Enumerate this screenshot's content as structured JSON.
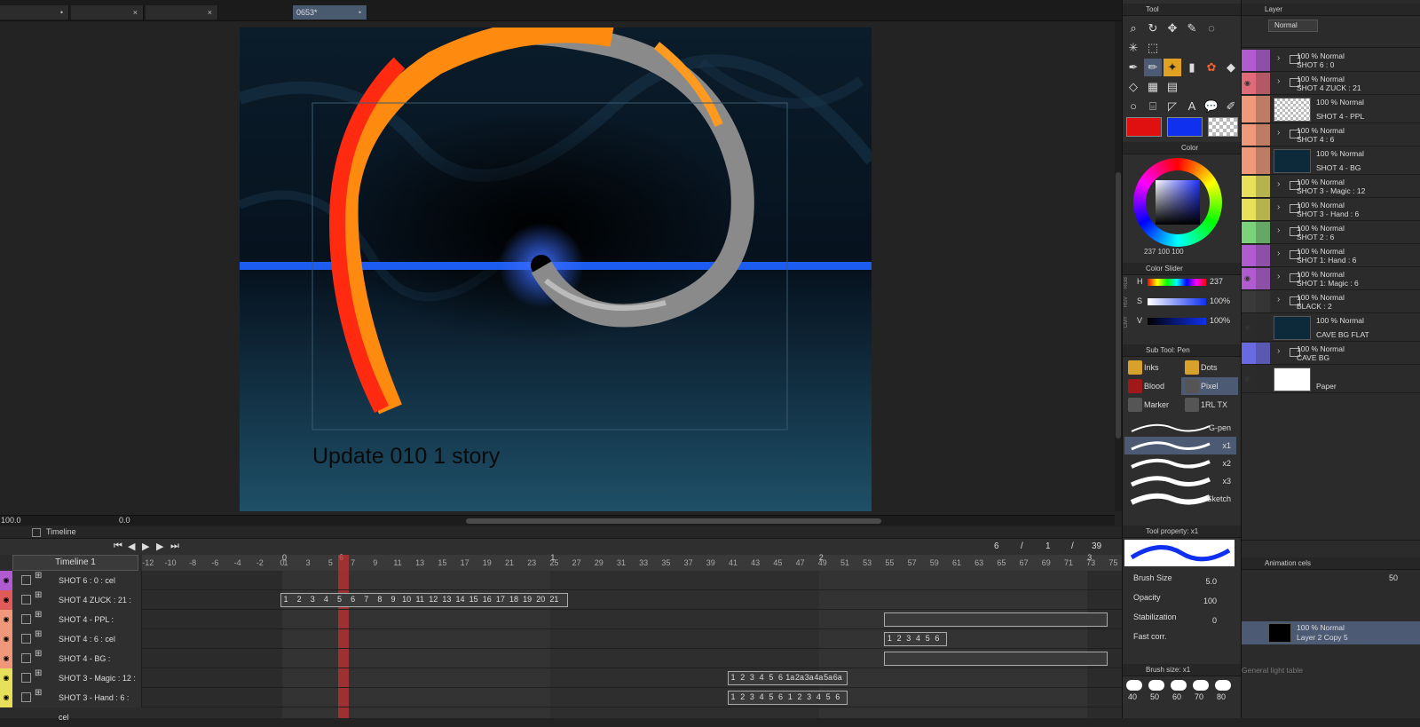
{
  "tabs": [
    {
      "label": "",
      "close": "•"
    },
    {
      "label": "",
      "close": "×"
    },
    {
      "label": "",
      "close": "×"
    },
    {
      "label": "0653*",
      "close": "•"
    }
  ],
  "canvas": {
    "caption": "Update 010 1 story"
  },
  "navigator": {
    "zoom": "100.0",
    "angle": "0.0"
  },
  "timeline": {
    "title": "Timeline",
    "selector": "Timeline 1",
    "frame_counter": {
      "current": "6",
      "sep1": "/",
      "a": "1",
      "sep2": "/",
      "total": "39"
    },
    "current_frame": 6,
    "ruler": [
      "-12",
      "-10",
      "-8",
      "-6",
      "-4",
      "-2",
      "0",
      "1",
      "3",
      "5",
      "7",
      "9",
      "11",
      "13",
      "15",
      "17",
      "19",
      "21",
      "23",
      "25",
      "27",
      "29",
      "31",
      "33",
      "35",
      "37",
      "39",
      "41",
      "43",
      "45",
      "47",
      "49",
      "51",
      "53",
      "55",
      "57",
      "59",
      "61",
      "63",
      "65",
      "67",
      "69",
      "71",
      "73",
      "75"
    ],
    "ruler_markers": [
      "0",
      "1",
      "2",
      "3"
    ],
    "tracks": [
      {
        "label": "SHOT 6 : 0 : cel",
        "color": "#b05cd0"
      },
      {
        "label": "SHOT 4 ZUCK : 21 : cel",
        "color": "#e05a5a"
      },
      {
        "label": "SHOT 4 - PPL :",
        "color": "#f0987a"
      },
      {
        "label": "SHOT 4 : 6 : cel",
        "color": "#f0987a"
      },
      {
        "label": "SHOT 4 - BG :",
        "color": "#f0987a"
      },
      {
        "label": "SHOT 3 - Magic : 12 : cel",
        "color": "#e6e05a"
      },
      {
        "label": "SHOT 3 - Hand : 6 : cel",
        "color": "#e6e05a"
      }
    ],
    "zuck_cels": [
      "1",
      "2",
      "3",
      "4",
      "5",
      "6",
      "7",
      "8",
      "9",
      "10",
      "11",
      "12",
      "13",
      "14",
      "15",
      "16",
      "17",
      "18",
      "19",
      "20",
      "21"
    ],
    "shot4_cels": [
      "1",
      "2",
      "3",
      "4",
      "5",
      "6"
    ],
    "magic_cels": [
      "1",
      "2",
      "3",
      "4",
      "5",
      "6",
      "1a",
      "2a",
      "3a",
      "4a",
      "5a",
      "6a"
    ],
    "hand_cels": [
      "1",
      "2",
      "3",
      "4",
      "5",
      "6",
      "1",
      "2",
      "3",
      "4",
      "5",
      "6"
    ]
  },
  "tool_panel": {
    "tool_title": "Tool",
    "color_title": "Color",
    "color_values": {
      "h": "237",
      "s": "100",
      "v": "100"
    },
    "slider_title": "Color Slider",
    "sliders": [
      {
        "label": "H",
        "value": "237"
      },
      {
        "label": "S",
        "value": "100%"
      },
      {
        "label": "V",
        "value": "100%"
      }
    ],
    "slider_tabs": [
      "RGB",
      "HSV",
      "CMY"
    ],
    "subtool_title": "Sub Tool: Pen",
    "subtools": [
      {
        "label": "Inks"
      },
      {
        "label": "Dots"
      },
      {
        "label": "Blood"
      },
      {
        "label": "Pixel"
      },
      {
        "label": "Marker"
      },
      {
        "label": "1RL TX"
      }
    ],
    "brushes": [
      "G-pen",
      "x1",
      "x2",
      "x3",
      "Sketch"
    ],
    "property_title": "Tool property: x1",
    "properties": [
      {
        "label": "Brush Size",
        "value": "5.0"
      },
      {
        "label": "Opacity",
        "value": "100"
      },
      {
        "label": "Stabilization",
        "value": "0"
      },
      {
        "label": "Fast corr.",
        "value": ""
      }
    ],
    "brush_size_title": "Brush size: x1",
    "brush_sizes": [
      "40",
      "50",
      "60",
      "70",
      "80"
    ],
    "main_color": "#e01010",
    "sub_color": "#1030f0"
  },
  "layer_panel": {
    "title": "Layer",
    "blend": "Normal",
    "layers": [
      {
        "mode": "100 % Normal",
        "name": "SHOT 6 : 0",
        "color": "#b05cd0",
        "type": "folder"
      },
      {
        "mode": "100 % Normal",
        "name": "SHOT 4 ZUCK : 21",
        "color": "#e06a7a",
        "type": "folder",
        "eye": true
      },
      {
        "mode": "100 % Normal",
        "name": "SHOT 4 - PPL",
        "color": "#f0987a",
        "type": "raster"
      },
      {
        "mode": "100 % Normal",
        "name": "SHOT 4 : 6",
        "color": "#f0987a",
        "type": "folder"
      },
      {
        "mode": "100 % Normal",
        "name": "SHOT 4 - BG",
        "color": "#f0987a",
        "type": "raster"
      },
      {
        "mode": "100 % Normal",
        "name": "SHOT 3 - Magic : 12",
        "color": "#e6e05a",
        "type": "folder"
      },
      {
        "mode": "100 % Normal",
        "name": "SHOT 3 - Hand : 6",
        "color": "#e6e05a",
        "type": "folder"
      },
      {
        "mode": "100 % Normal",
        "name": "SHOT 2 : 6",
        "color": "#7ad27a",
        "type": "folder"
      },
      {
        "mode": "100 % Normal",
        "name": "SHOT 1: Hand : 6",
        "color": "#b05cd0",
        "type": "folder"
      },
      {
        "mode": "100 % Normal",
        "name": "SHOT 1: Magic : 6",
        "color": "#b05cd0",
        "type": "folder",
        "eye": true
      },
      {
        "mode": "100 % Normal",
        "name": "BLACK : 2",
        "color": "#3a3a3a",
        "type": "folder"
      },
      {
        "mode": "100 % Normal",
        "name": "CAVE BG FLAT",
        "color": "#2b2b2b",
        "type": "raster",
        "eye": true
      },
      {
        "mode": "100 % Normal",
        "name": "CAVE BG",
        "color": "#6a6ae0",
        "type": "folder"
      },
      {
        "mode": "",
        "name": "Paper",
        "color": "#2b2b2b",
        "type": "paper",
        "eye": true
      }
    ],
    "anim_cels_title": "Animation cels",
    "anim_opacity": "50",
    "anim_layer": {
      "mode": "100 % Normal",
      "name": "Layer 2 Copy 5"
    },
    "light_table": "General light table"
  }
}
